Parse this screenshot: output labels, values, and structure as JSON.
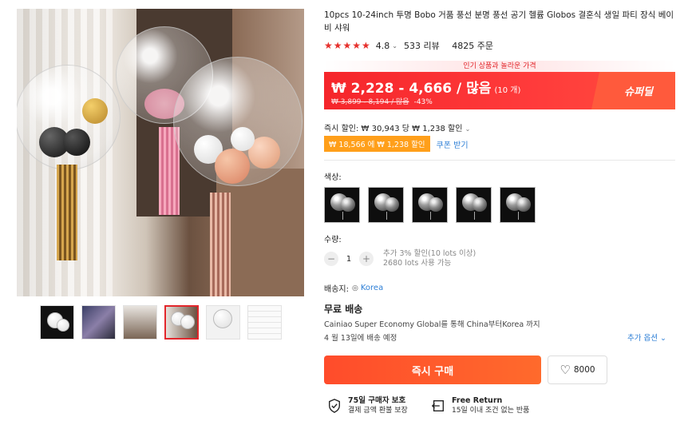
{
  "product": {
    "title": "10pcs 10-24inch 투명 Bobo 거품 풍선 분명 풍선 공기 헬륨 Globos 결혼식 생일 파티 장식 베이비 샤워",
    "stars": "★★★★★",
    "rating": "4.8",
    "reviews": "533 리뷰",
    "orders": "4825 주문"
  },
  "price": {
    "promo_label": "인기 상품과 놀라운 가격",
    "range": "₩ 2,228 - 4,666 / 많음",
    "unit_note": "(10 개)",
    "original": "₩ 3,899 - 8,194 / 많음",
    "discount": "-43%",
    "super_deal": "슈퍼딜",
    "instant_discount": "즉시 할인: ₩ 30,943 당 ₩ 1,238 할인",
    "coupon_badge": "₩ 18,566 에 ₩ 1,238 할인",
    "coupon_link": "쿠폰 받기"
  },
  "options": {
    "color_label": "색상:",
    "swatch_count": 5
  },
  "quantity": {
    "label": "수량:",
    "minus": "−",
    "value": "1",
    "plus": "+",
    "note1": "추가 3% 할인(10 lots 이상)",
    "note2": "2680 lots 사용 가능"
  },
  "shipping": {
    "ship_to_label": "배송지:",
    "country": "Korea",
    "free_shipping": "무료 배송",
    "via": "Cainiao Super Economy Global를 통해 China부터Korea 까지",
    "date": "4 월 13일에 배송 예정",
    "more_options": "추가 옵션"
  },
  "actions": {
    "buy_now": "즉시 구매",
    "wishlist_count": "8000"
  },
  "guarantees": [
    {
      "title": "75일 구매자 보호",
      "sub": "결제 금액 환불 보장"
    },
    {
      "title": "Free Return",
      "sub": "15일 이내 조건 없는 반품"
    }
  ],
  "colors": {
    "accent_red": "#e2262b",
    "coupon_orange": "#ff9f1a",
    "link_blue": "#2e7fd6"
  }
}
